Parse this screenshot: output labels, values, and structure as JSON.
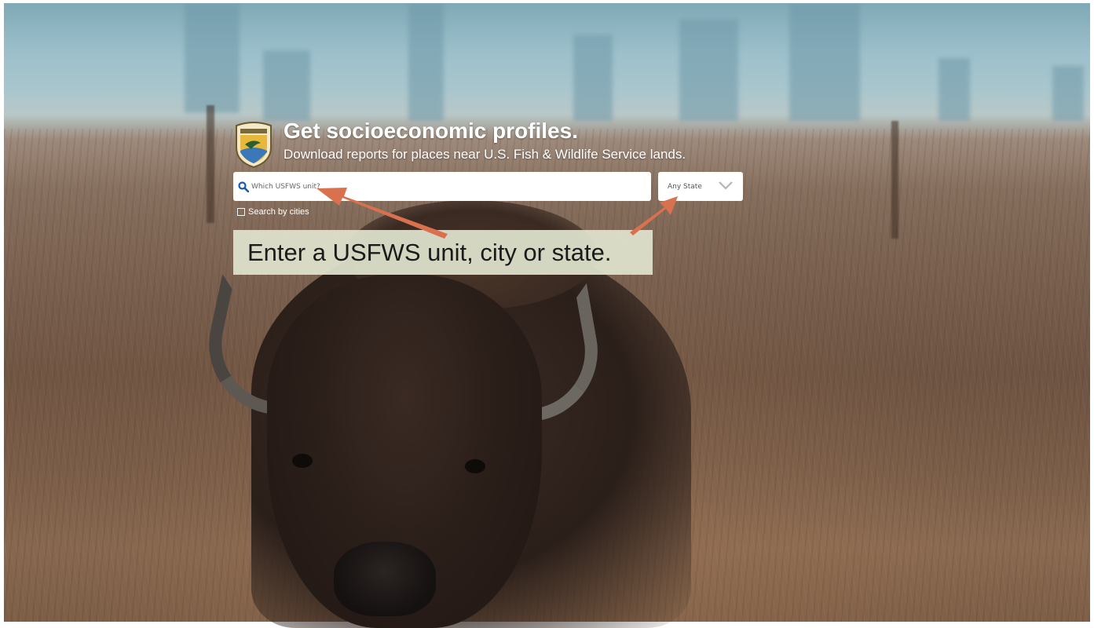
{
  "hero": {
    "title": "Get socioeconomic profiles.",
    "subtitle": "Download reports for places near U.S. Fish & Wildlife Service lands."
  },
  "search": {
    "placeholder": "Which USFWS unit?",
    "state_select": {
      "selected": "Any State"
    },
    "cities_checkbox": {
      "label": "Search by cities",
      "checked": false
    }
  },
  "annotation": {
    "text": "Enter a USFWS unit, city or state.",
    "arrow_color": "#d9714f"
  },
  "icons": {
    "logo": "usfws-shield-logo",
    "search": "search-icon",
    "dropdown": "chevron-down-icon"
  },
  "colors": {
    "text_on_image": "#ffffff",
    "callout_background": "#dfe3cd",
    "search_icon": "#1a5aa8"
  }
}
